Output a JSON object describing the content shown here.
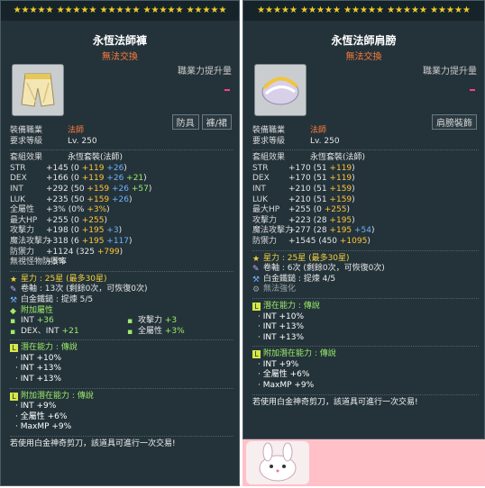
{
  "left": {
    "title": "永恆法師褲",
    "sub": "無法交換",
    "power_label": "職業力提升量",
    "tags": [
      "防具",
      "褲/裙"
    ],
    "job_label": "裝備職業",
    "job_value": "法師",
    "req_label": "要求等級",
    "req_value": "Lv. 250",
    "set_label": "套組效果",
    "set_value": "永恆套裝(法師)",
    "stats": [
      {
        "n": "STR",
        "v": "+145",
        "d": "(0 +119 +26)"
      },
      {
        "n": "DEX",
        "v": "+166",
        "d": "(0 +119 +26 +21)"
      },
      {
        "n": "INT",
        "v": "+292",
        "d": "(50 +159 +26 +57)"
      },
      {
        "n": "LUK",
        "v": "+235",
        "d": "(50 +159 +26)"
      },
      {
        "n": "全屬性",
        "v": "+3%",
        "d": "(0% +3%)"
      },
      {
        "n": "最大HP",
        "v": "+255",
        "d": "(0 +255)"
      },
      {
        "n": "攻擊力",
        "v": "+198",
        "d": "(0 +195 +3)"
      },
      {
        "n": "魔法攻擊力",
        "v": "+318",
        "d": "(6 +195 +117)"
      },
      {
        "n": "防禦力",
        "v": "+1124",
        "d": "(325 +799)"
      },
      {
        "n": "無視怪物防禦率",
        "v": "+5%",
        "d": ""
      }
    ],
    "star": "星力 : 25星 (最多30星)",
    "scroll": "卷軸 : 13次 (剩餘0次，可恢復0次)",
    "hammer": "白金鐵鎚 : 提煉 5/5",
    "add_attr": "附加屬性",
    "add_rows": [
      [
        "INT",
        "+36",
        "攻擊力",
        "+3"
      ],
      [
        "DEX、INT",
        "+21",
        "全屬性",
        "+3%"
      ]
    ],
    "pot_hdr": "潛在能力 : 傳說",
    "pot": [
      "INT +10%",
      "INT +13%",
      "INT +13%"
    ],
    "addpot_hdr": "附加潛在能力 : 傳說",
    "addpot": [
      "INT +9%",
      "全屬性 +6%",
      "MaxMP +9%"
    ],
    "footer": "若使用白金神奇剪刀，該道具可進行一次交易!"
  },
  "right": {
    "title": "永恆法師肩膀",
    "sub": "無法交換",
    "power_label": "職業力提升量",
    "tags": [
      "肩膀裝飾"
    ],
    "job_label": "裝備職業",
    "job_value": "法師",
    "req_label": "要求等級",
    "req_value": "Lv. 250",
    "set_label": "套組效果",
    "set_value": "永恆套裝(法師)",
    "stats": [
      {
        "n": "STR",
        "v": "+170",
        "d": "(51 +119)"
      },
      {
        "n": "DEX",
        "v": "+170",
        "d": "(51 +119)"
      },
      {
        "n": "INT",
        "v": "+210",
        "d": "(51 +159)"
      },
      {
        "n": "LUK",
        "v": "+210",
        "d": "(51 +159)"
      },
      {
        "n": "最大HP",
        "v": "+255",
        "d": "(0 +255)"
      },
      {
        "n": "攻擊力",
        "v": "+223",
        "d": "(28 +195)"
      },
      {
        "n": "魔法攻擊力",
        "v": "+277",
        "d": "(28 +195 +54)"
      },
      {
        "n": "防禦力",
        "v": "+1545",
        "d": "(450 +1095)"
      }
    ],
    "star": "星力 : 25星 (最多30星)",
    "scroll": "卷軸 : 6次 (剩餘0次，可恢復0次)",
    "hammer": "白金鐵鎚 : 提煉 4/5",
    "reinforce": "無法強化",
    "pot_hdr": "潛在能力 : 傳說",
    "pot": [
      "INT +10%",
      "INT +13%",
      "INT +13%"
    ],
    "addpot_hdr": "附加潛在能力 : 傳說",
    "addpot": [
      "INT +9%",
      "全屬性 +6%",
      "MaxMP +9%"
    ],
    "footer": "若使用白金神奇剪刀，該道具可進行一次交易!"
  },
  "stars_row": "★★★★★ ★★★★★ ★★★★★ ★★★★★ ★★★★★",
  "colors": {
    "panel": "#24333a",
    "header": "#16242a",
    "star": "#f1cc2a",
    "orange": "#ff7b3a",
    "yellow": "#ffc53a",
    "blue": "#6fb2ff",
    "green": "#9eed6a",
    "pink": "#ffc0c8"
  }
}
